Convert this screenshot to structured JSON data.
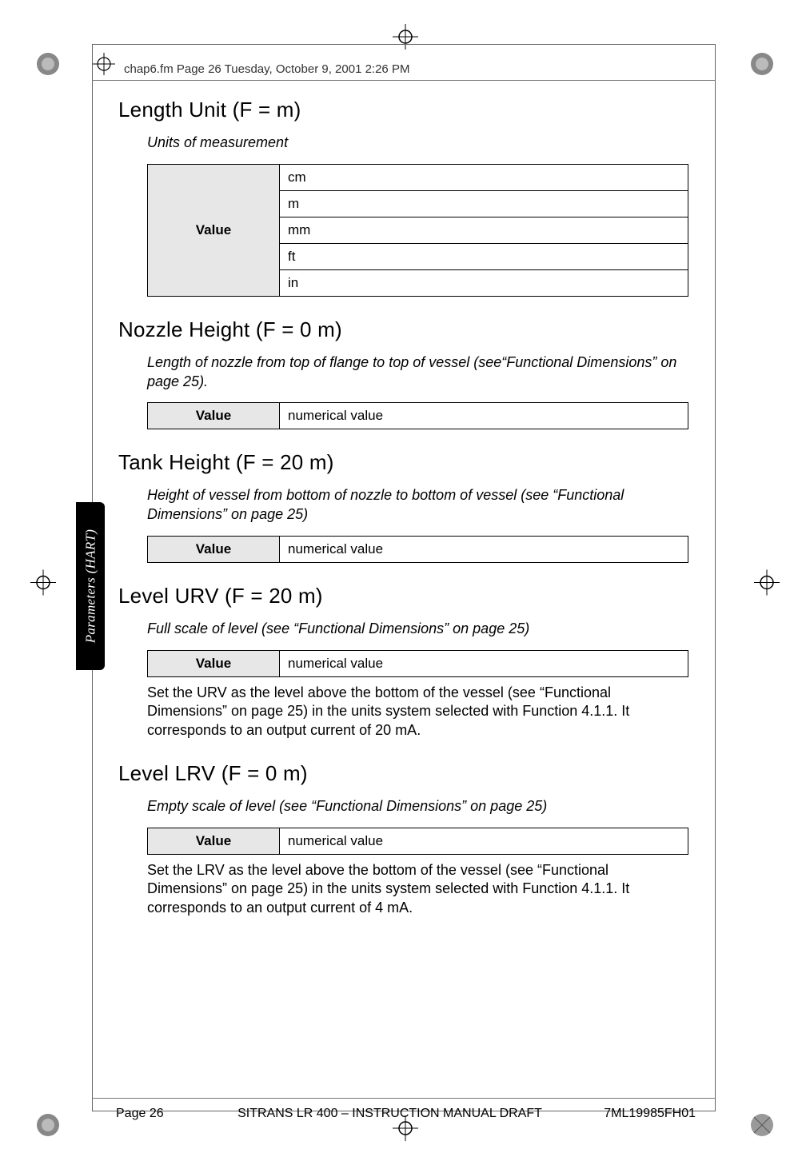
{
  "running_header": "chap6.fm  Page 26  Tuesday, October 9, 2001  2:26 PM",
  "side_tab": "Parameters (HART)",
  "sections": {
    "length_unit": {
      "title": "Length Unit (F = m)",
      "subtitle": "Units of measurement",
      "row_header": "Value",
      "rows": [
        "cm",
        "m",
        "mm",
        "ft",
        "in"
      ]
    },
    "nozzle_height": {
      "title": "Nozzle Height (F = 0 m)",
      "subtitle": "Length of nozzle from top of flange to top of vessel (see“Functional Dimensions” on page 25).",
      "row_header": "Value",
      "row_value": "numerical value"
    },
    "tank_height": {
      "title": "Tank Height (F = 20 m)",
      "subtitle": "Height of vessel from bottom of nozzle to bottom of vessel (see “Functional Dimensions” on page 25)",
      "row_header": "Value",
      "row_value": "numerical value"
    },
    "level_urv": {
      "title": "Level URV (F = 20 m)",
      "subtitle": "Full scale of level (see “Functional Dimensions” on page 25)",
      "row_header": "Value",
      "row_value": "numerical value",
      "body": "Set the URV as the level above the bottom of the vessel (see “Functional Dimensions” on page 25) in the units system selected with Function 4.1.1. It corresponds to an output current of 20 mA."
    },
    "level_lrv": {
      "title": "Level LRV (F = 0 m)",
      "subtitle": "Empty scale of level (see “Functional Dimensions” on page 25)",
      "row_header": "Value",
      "row_value": "numerical value",
      "body": "Set the LRV as the level above the bottom of the vessel (see “Functional Dimensions” on page 25) in the units system selected with Function 4.1.1. It corresponds to an output current of 4 mA."
    }
  },
  "footer": {
    "left": "Page 26",
    "center": "SITRANS LR 400 – INSTRUCTION MANUAL DRAFT",
    "right": "7ML19985FH01"
  }
}
